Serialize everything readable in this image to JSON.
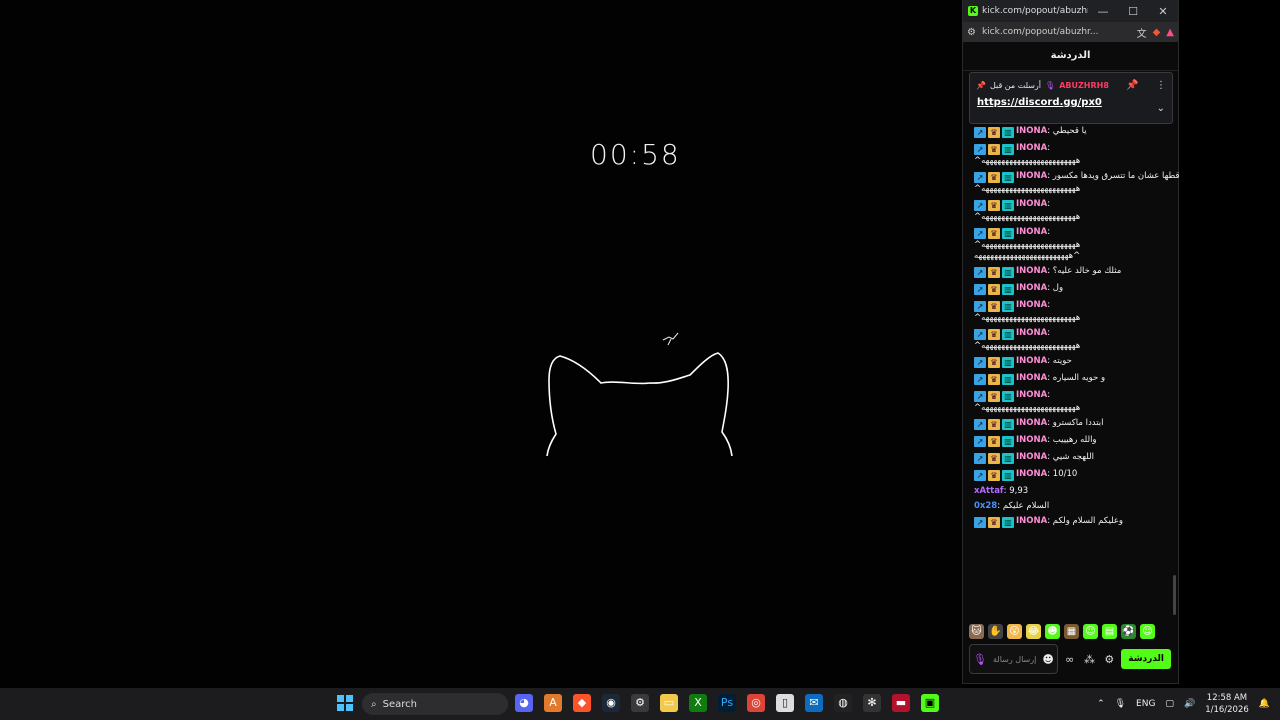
{
  "stage": {
    "timer": "00:58"
  },
  "browser": {
    "title": "kick.com/popout/abuzhrh8/...",
    "url": "kick.com/popout/abuzhr...",
    "window_controls": [
      "—",
      "☐",
      "✕"
    ]
  },
  "chat": {
    "header": "الدردشة",
    "pinned": {
      "label": "أرسلت من قبل",
      "sender": "ABUZHRH8",
      "link": "https://discord.gg/px0"
    },
    "messages": [
      {
        "user": "INONA",
        "color": "#ff8fd6",
        "badges": true,
        "text": "يا قحيطي",
        "cont": ""
      },
      {
        "user": "INONA",
        "color": "#ff8fd6",
        "badges": true,
        "text": "",
        "cont": "^ههههههههههههههههههههههههه"
      },
      {
        "user": "INONA",
        "color": "#ff8fd6",
        "badges": true,
        "text": "قطها عشان ما تتسرق ويدها مكسور",
        "cont": "^ههههههههههههههههههههههههه"
      },
      {
        "user": "INONA",
        "color": "#ff8fd6",
        "badges": true,
        "text": "",
        "cont": "^ههههههههههههههههههههههههه"
      },
      {
        "user": "INONA",
        "color": "#ff8fd6",
        "badges": true,
        "text": "",
        "cont": "^ههههههههههههههههههههههههه ^ههههههههههههههههههههههههه"
      },
      {
        "user": "INONA",
        "color": "#ff8fd6",
        "badges": true,
        "text": "مثلك مو خالد عليه؟",
        "cont": ""
      },
      {
        "user": "INONA",
        "color": "#ff8fd6",
        "badges": true,
        "text": "ول",
        "cont": ""
      },
      {
        "user": "INONA",
        "color": "#ff8fd6",
        "badges": true,
        "text": "",
        "cont": "^ههههههههههههههههههههههههه"
      },
      {
        "user": "INONA",
        "color": "#ff8fd6",
        "badges": true,
        "text": "",
        "cont": "^ههههههههههههههههههههههههه"
      },
      {
        "user": "INONA",
        "color": "#ff8fd6",
        "badges": true,
        "text": "حويته",
        "cont": ""
      },
      {
        "user": "INONA",
        "color": "#ff8fd6",
        "badges": true,
        "text": "و حويه السياره",
        "cont": ""
      },
      {
        "user": "INONA",
        "color": "#ff8fd6",
        "badges": true,
        "text": "",
        "cont": "^ههههههههههههههههههههههههه"
      },
      {
        "user": "INONA",
        "color": "#ff8fd6",
        "badges": true,
        "text": "ابتددا ماكسترو",
        "cont": ""
      },
      {
        "user": "INONA",
        "color": "#ff8fd6",
        "badges": true,
        "text": "والله رهيييب",
        "cont": ""
      },
      {
        "user": "INONA",
        "color": "#ff8fd6",
        "badges": true,
        "text": "اللهجه شيي",
        "cont": ""
      },
      {
        "user": "INONA",
        "color": "#ff8fd6",
        "badges": true,
        "text": "10/10",
        "cont": ""
      },
      {
        "user": "xAttaf",
        "color": "#b36bff",
        "badges": false,
        "text": "9,93",
        "cont": ""
      },
      {
        "user": "0x28",
        "color": "#4a90ff",
        "badges": false,
        "text": "السلام عليكم",
        "cont": ""
      },
      {
        "user": "INONA",
        "color": "#ff8fd6",
        "badges": true,
        "text": "وعليكم السلام ولكم",
        "cont": ""
      }
    ],
    "input_placeholder": "إرسال رسالة",
    "send_button": "الدردشة"
  },
  "taskbar": {
    "search_label": "Search",
    "language": "ENG",
    "time": "12:58 AM",
    "date": "1/16/2026"
  },
  "colors": {
    "kick_green": "#53fc18",
    "windows_accent": "#4cc2ff"
  }
}
